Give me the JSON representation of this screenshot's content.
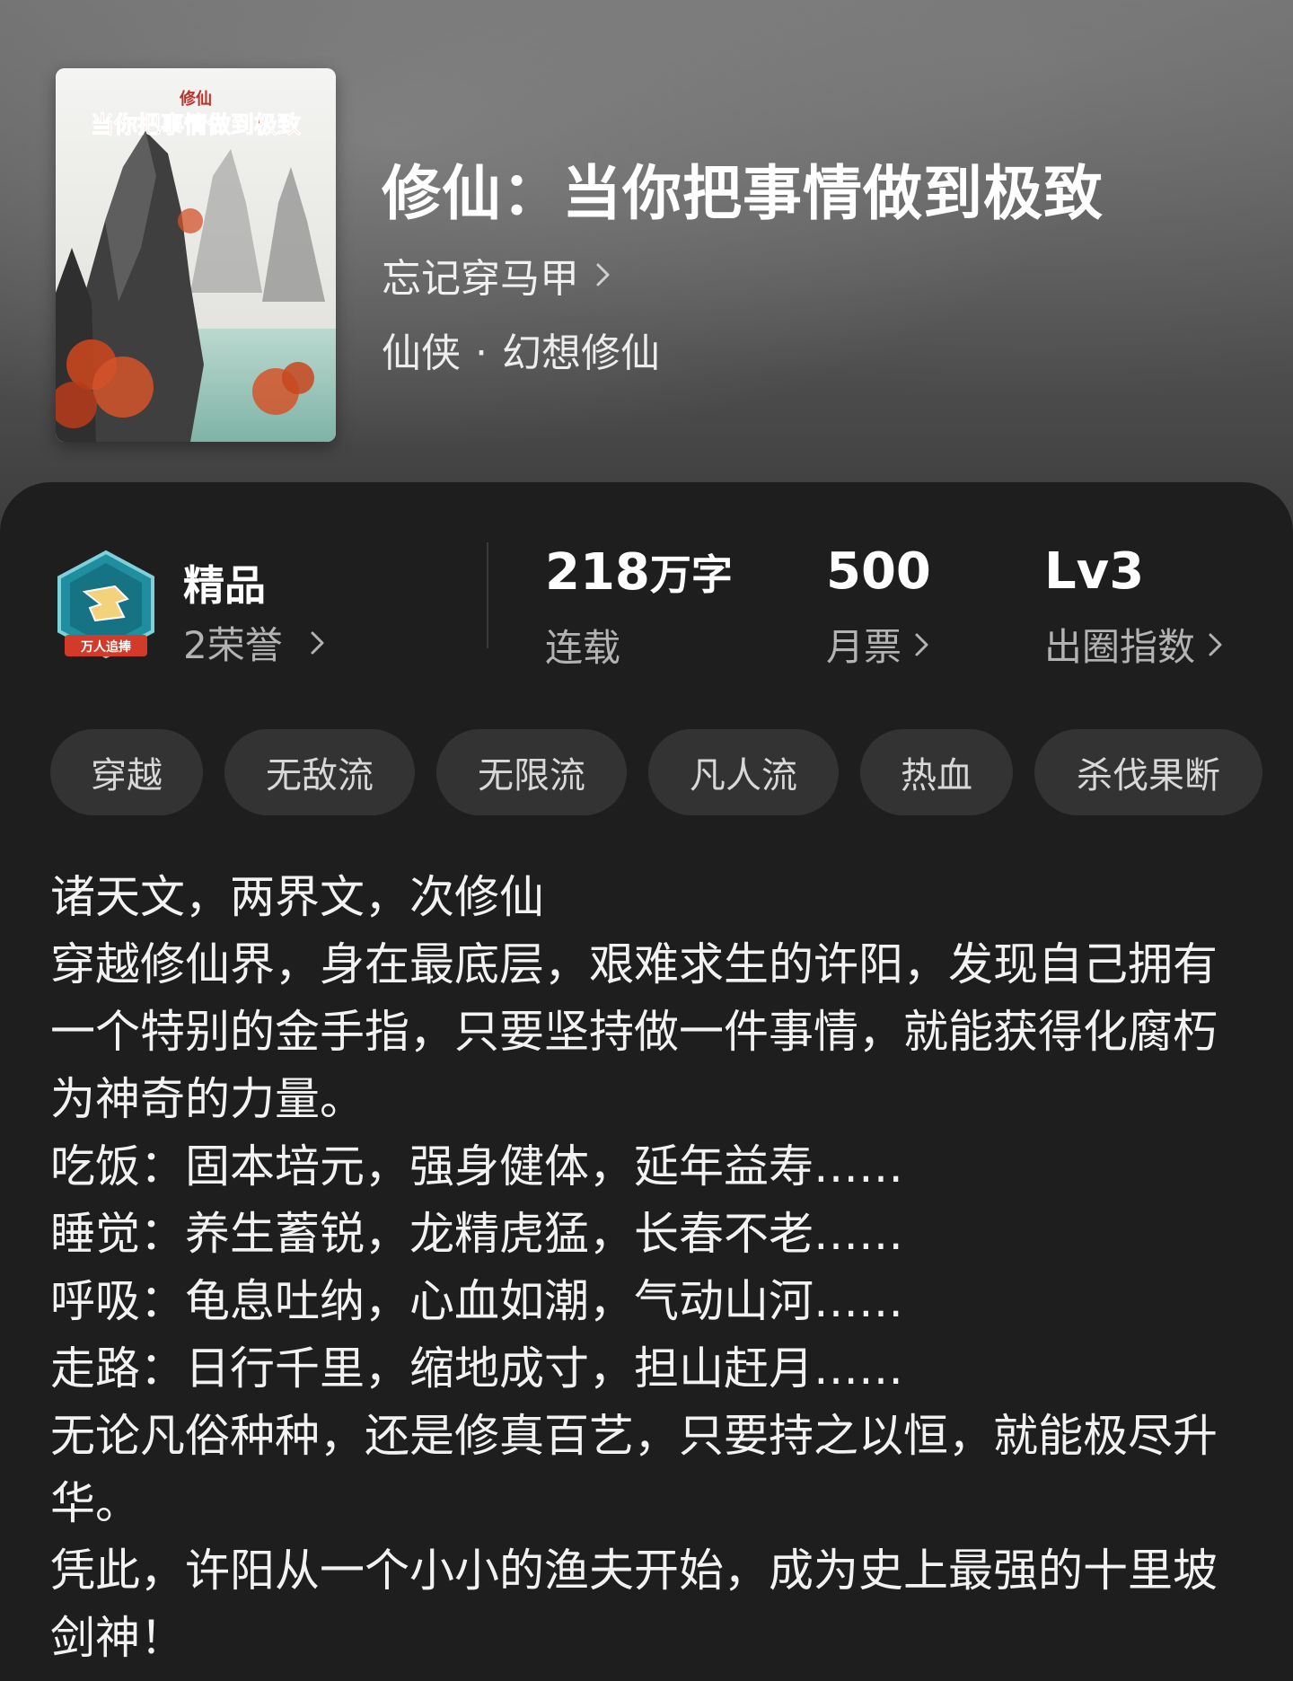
{
  "book": {
    "title": "修仙：当你把事情做到极致",
    "author": "忘记穿马甲",
    "genre_primary": "仙侠",
    "genre_secondary": "幻想修仙",
    "cover": {
      "title_small": "修仙",
      "title_main": "当你把事情做到极致"
    }
  },
  "honor": {
    "title": "精品",
    "subtitle": "2荣誉",
    "badge_text": "万人追捧"
  },
  "stats": [
    {
      "value": "218",
      "unit": "万字",
      "label": "连载",
      "link": false
    },
    {
      "value": "500",
      "unit": "",
      "label": "月票",
      "link": true
    },
    {
      "value": "Lv3",
      "unit": "",
      "label": "出圈指数",
      "link": true
    }
  ],
  "tags": [
    "穿越",
    "无敌流",
    "无限流",
    "凡人流",
    "热血",
    "杀伐果断"
  ],
  "synopsis": [
    "诸天文，两界文，次修仙",
    "穿越修仙界，身在最底层，艰难求生的许阳，发现自己拥有一个特别的金手指，只要坚持做一件事情，就能获得化腐朽为神奇的力量。",
    "吃饭：固本培元，强身健体，延年益寿……",
    "睡觉：养生蓄锐，龙精虎猛，长春不老……",
    "呼吸：龟息吐纳，心血如潮，气动山河……",
    "走路：日行千里，缩地成寸，担山赶月……",
    "无论凡俗种种，还是修真百艺，只要持之以恒，就能极尽升华。",
    "凭此，许阳从一个小小的渔夫开始，成为史上最强的十里坡剑神！"
  ],
  "colors": {
    "panel_bg": "#1e1e1e",
    "tag_bg": "#333333",
    "muted_text": "#b3b3b3",
    "badge_teal": "#1f8fa0",
    "badge_red": "#d23a2a"
  },
  "icons": {
    "chevron": "chevron-right-icon",
    "badge": "honor-badge-icon"
  }
}
